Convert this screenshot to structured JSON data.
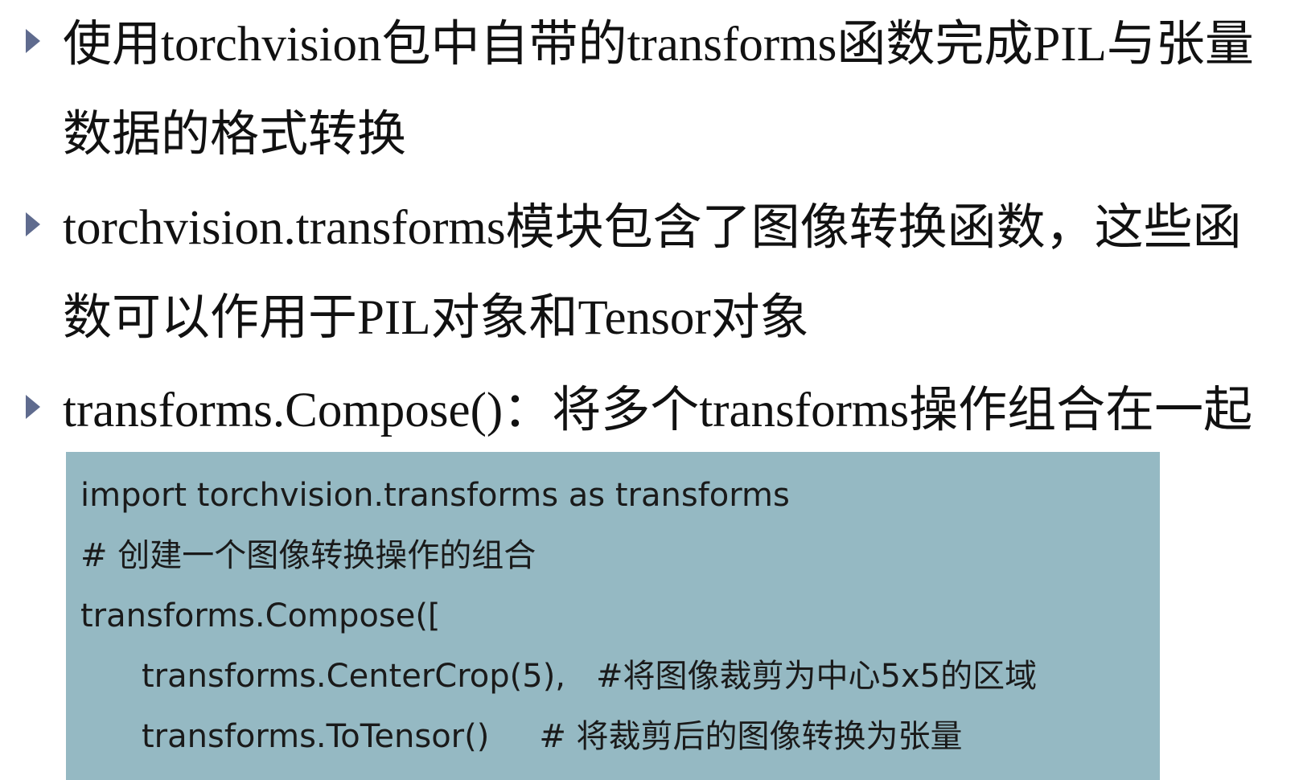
{
  "bullets": [
    {
      "text": "使用torchvision包中自带的transforms函数完成PIL与张量数据的格式转换"
    },
    {
      "text": "torchvision.transforms模块包含了图像转换函数，这些函数可以作用于PIL对象和Tensor对象"
    },
    {
      "text": "transforms.Compose()：将多个transforms操作组合在一起"
    }
  ],
  "code": {
    "lines": [
      {
        "code": "import torchvision.transforms as transforms",
        "comment": ""
      },
      {
        "code": "# 创建一个图像转换操作的组合",
        "comment": ""
      },
      {
        "code": "transforms.Compose([",
        "comment": ""
      },
      {
        "code": "transforms.CenterCrop(5),",
        "comment": "#将图像裁剪为中心5x5的区域"
      },
      {
        "code": "transforms.ToTensor()",
        "comment": "# 将裁剪后的图像转换为张量"
      }
    ]
  },
  "colors": {
    "bullet_marker": "#5f6b8e",
    "code_background": "#95b9c3",
    "text": "#111111"
  },
  "icons": {
    "bullet_marker": "triangle-right-icon"
  }
}
